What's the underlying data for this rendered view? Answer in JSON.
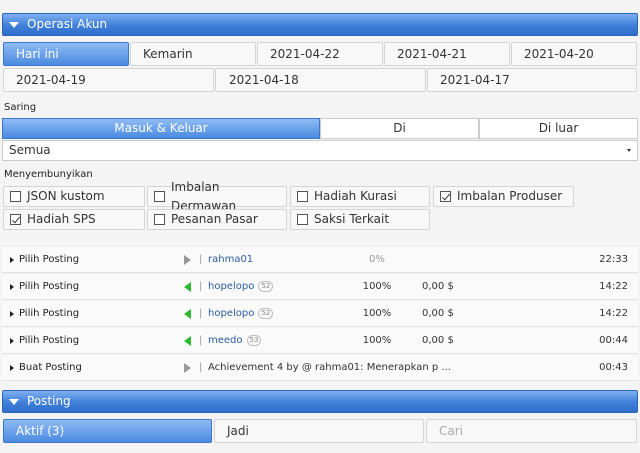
{
  "account_ops": {
    "title": "Operasi Akun",
    "dates": [
      "Hari ini",
      "Kemarin",
      "2021-04-22",
      "2021-04-21",
      "2021-04-20",
      "2021-04-19",
      "2021-04-18",
      "2021-04-17"
    ],
    "filter_label": "Saring",
    "filter_tabs": [
      "Masuk & Keluar",
      "Di",
      "Di luar"
    ],
    "select_value": "Semua",
    "hide_label": "Menyembunyikan",
    "hide_options": [
      {
        "label": "JSON kustom",
        "checked": false
      },
      {
        "label": "Imbalan Dermawan",
        "checked": false
      },
      {
        "label": "Hadiah Kurasi",
        "checked": false
      },
      {
        "label": "Imbalan Produser",
        "checked": true
      },
      {
        "label": "Hadiah SPS",
        "checked": true
      },
      {
        "label": "Pesanan Pasar",
        "checked": false
      },
      {
        "label": "Saksi Terkait",
        "checked": false
      }
    ],
    "operations": [
      {
        "action": "Pilih Posting",
        "author": "rahma01",
        "rep": "",
        "percent": "0%",
        "amount": "",
        "time": "22:33"
      },
      {
        "action": "Pilih Posting",
        "author": "hopelopo",
        "rep": "52",
        "percent": "100%",
        "amount": "0,00 $",
        "time": "14:22"
      },
      {
        "action": "Pilih Posting",
        "author": "hopelopo",
        "rep": "52",
        "percent": "100%",
        "amount": "0,00 $",
        "time": "14:22"
      },
      {
        "action": "Pilih Posting",
        "author": "meedo",
        "rep": "53",
        "percent": "100%",
        "amount": "0,00 $",
        "time": "00:44"
      },
      {
        "action": "Buat Posting",
        "title": "Achievement 4 by @ rahma01: Menerapkan p ...",
        "time": "00:43"
      }
    ]
  },
  "posting": {
    "title": "Posting",
    "tabs": [
      "Aktif (3)",
      "Jadi",
      "Cari"
    ]
  }
}
